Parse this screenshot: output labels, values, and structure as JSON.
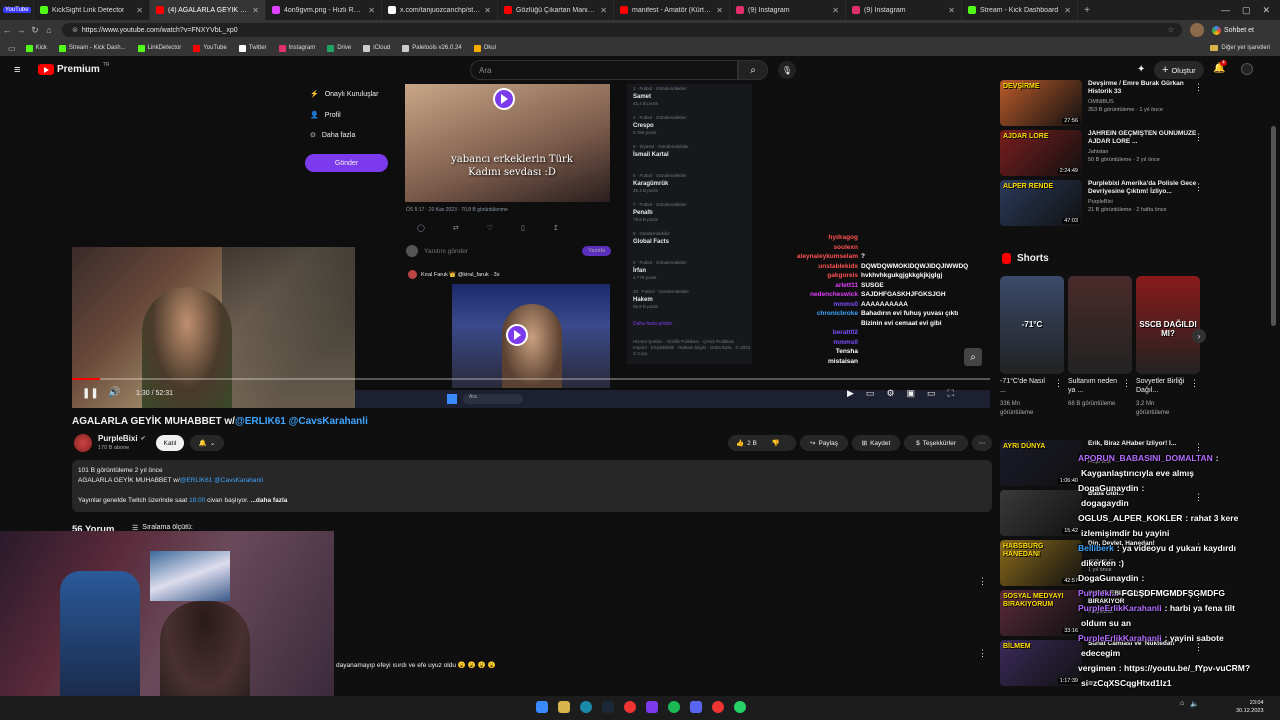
{
  "tabs": [
    {
      "label": "KickSight Link Detector",
      "color": "#53fc18"
    },
    {
      "label": "(4) AGALARLA GEYİK MUHABBET",
      "color": "#ff0000"
    },
    {
      "label": "4on9gvm.png - Hızlı Resim",
      "color": "#e040fb"
    },
    {
      "label": "x.com/tanjuozcanchp/status/2005",
      "color": "#ffffff"
    },
    {
      "label": "Gözlüğü Çıkartan Manifest Vlog -",
      "color": "#ff0000"
    },
    {
      "label": "manifest - Amatör (Kürtçe Cover)",
      "color": "#ff0000"
    },
    {
      "label": "(9) Instagram",
      "color": "#e1306c"
    },
    {
      "label": "(9) Instagram",
      "color": "#e1306c"
    },
    {
      "label": "Stream - Kick Dashboard",
      "color": "#53fc18"
    }
  ],
  "youtube_tab_badge": "YouTube",
  "url": "https://www.youtube.com/watch?v=FNXYVbL_xp0",
  "chat_button": "Sohbet et",
  "bookmarks": [
    {
      "label": "Kick",
      "color": "#53fc18"
    },
    {
      "label": "Stream - Kick Dash...",
      "color": "#53fc18"
    },
    {
      "label": "LinkDetector",
      "color": "#53fc18"
    },
    {
      "label": "YouTube",
      "color": "#ff0000"
    },
    {
      "label": "Twitter",
      "color": "#ffffff"
    },
    {
      "label": "Instagram",
      "color": "#e1306c"
    },
    {
      "label": "Drive",
      "color": "#1fa463"
    },
    {
      "label": "iCloud",
      "color": "#cccccc"
    },
    {
      "label": "Paletools v26.0.24",
      "color": "#cccccc"
    },
    {
      "label": "Okul",
      "color": "#f9ab00"
    }
  ],
  "other_bookmarks": "Diğer yer işaretleri",
  "yt": {
    "logo": "Premium",
    "logo_super": "TR",
    "search_placeholder": "Ara",
    "create": "Oluştur",
    "notif_count": "4"
  },
  "player": {
    "menu_items": [
      "Onaylı Kuruluşlar",
      "Profil",
      "Daha fazla"
    ],
    "send_button": "Gönder",
    "tweet_caption_line1": "yabancı erkeklerin Türk",
    "tweet_caption_line2": "Kadını sevdası :D",
    "tweet_meta": "ÖS 5:17 · 20 Kas 2023 · 70,8 B görüntülenme",
    "reply_placeholder": "Yanıtını gönder",
    "reply_button": "Yanıtla",
    "quote_user": "Kıral Faruk 👑 @kiral_faruk · 3s",
    "trends": [
      {
        "cat": "1 · Futbol · Gündemdekiler",
        "name": "Samet",
        "count": "45,4 B posts"
      },
      {
        "cat": "4 · Futbol · Gündemdekiler",
        "name": "Crespo",
        "count": "5.786 posts"
      },
      {
        "cat": "5 · Siyaset · Gündemdekiler",
        "name": "İsmail Kartal",
        "count": ""
      },
      {
        "cat": "6 · Futbol · Gündemdekiler",
        "name": "Karagümrük",
        "count": "25,4 B posts"
      },
      {
        "cat": "7 · Futbol · Gündemdekiler",
        "name": "Penaltı",
        "count": "79,8 B posts"
      },
      {
        "cat": "8 · Gündemdekiler",
        "name": "Global Facts",
        "count": ""
      },
      {
        "cat": "9 · Futbol · Gündemdekiler",
        "name": "İrfan",
        "count": "4.775 posts"
      },
      {
        "cat": "10 · Futbol · Gündemdekiler",
        "name": "Hakem",
        "count": "95,8 B posts"
      }
    ],
    "show_more": "Daha fazla göster",
    "footer": "Hizmet Şartları · Gizlilik Politikası · Çerez Politikası · Imprint · Erişilebilirlik · Reklam bilgisi · Daha fazla · © 2023 X Corp.",
    "chat": [
      {
        "user": "hydragog",
        "msg": "",
        "color": "#ff5252"
      },
      {
        "user": "soulexn",
        "msg": "",
        "color": "#ff5252"
      },
      {
        "user": "aleynaleykumselam",
        "msg": "?",
        "color": "#ff5252"
      },
      {
        "user": "unstablekidx",
        "msg": "DQWDQWMOKIDQWJIDQJIWWDQ",
        "color": "#ff5252"
      },
      {
        "user": "gakgoreis",
        "msg": "hvkhvhkgukgjgkkgkjkjglgj",
        "color": "#ff5252"
      },
      {
        "user": "arlett11",
        "msg": "SUSGE",
        "color": "#e040fb"
      },
      {
        "user": "nedencheswick",
        "msg": "SAJDHFGASKHJFGKSJGH",
        "color": "#e040fb"
      },
      {
        "user": "mmms0",
        "msg": "AAAAAAAAAA",
        "color": "#7c4dff"
      },
      {
        "user": "chronicbroke",
        "msg": "Bahadırın evi fuhuş yuvası çıktı",
        "color": "#3ea6ff"
      },
      {
        "user": "",
        "msg": "Bizinin evi cemaat evi gibi",
        "color": "#3ea6ff"
      },
      {
        "user": "beratt02",
        "msg": "",
        "color": "#7c4dff"
      },
      {
        "user": "mmms0",
        "msg": "",
        "color": "#7c4dff"
      },
      {
        "user": "Tensha",
        "msg": "",
        "color": "#ffffff"
      },
      {
        "user": "mistaisan",
        "msg": "",
        "color": "#ffffff"
      }
    ],
    "timecode": "1:30 / 52:31",
    "progress": 0.03,
    "taskbar_time": "23:04\n30.12.2023"
  },
  "video": {
    "title": "AGALARLA GEYİK MUHABBET w/",
    "title_links": "@ERLIK61 @CavsKarahanli",
    "channel": "PurpleBixi",
    "subscribers": "170 B abone",
    "join": "Katıl",
    "likes": "2 B",
    "share": "Paylaş",
    "save": "Kaydet",
    "thanks": "Teşekkürler"
  },
  "description": {
    "meta": "101 B görüntüleme  2 yıl önce",
    "line2_text": "AGALARLA GEYİK MUHABBET w/",
    "line2_links": "@ERLIK61 @CavsKarahanli",
    "line3_prefix": "Yayınlar genelde Twitch üzerinde saat",
    "line3_time": "18:00",
    "line3_suffix": "civarı başlıyor.",
    "more": "...daha fazla"
  },
  "comments": {
    "count": "56 Yorum",
    "sort": "Sıralama ölçütü:",
    "visible_comment": "dayanamayıp efeyi ısırdı ve efe uyuz oldu 😮 😮 😮 😮"
  },
  "recommended_top": [
    {
      "title": "Devşirme / Emre Burak Gürkan Historik 33",
      "channel": "OMNIBUS",
      "meta": "353 B görüntüleme · 1 yıl önce",
      "duration": "27:56",
      "thumb_text": "DEVŞİRME",
      "color": "#b85a2a"
    },
    {
      "title": "JAHREIN GEÇMİŞTEN GÜNÜMÜZE AJDAR LORE ...",
      "channel": "Jahistan",
      "meta": "50 B görüntüleme · 2 yıl önce",
      "duration": "2:24:49",
      "thumb_text": "AJDAR LORE",
      "color": "#7a1d1d"
    },
    {
      "title": "Purplebixi Amerika'da Polisle Gece Devriyesine Çıktım! İzliyo...",
      "channel": "PurpleBixi",
      "meta": "21 B görüntüleme · 2 hafta önce",
      "duration": "47:03",
      "thumb_text": "ALPER RENDE",
      "color": "#2a3a5a"
    }
  ],
  "shorts": {
    "heading": "Shorts",
    "items": [
      {
        "title": "-71°C'de Nasıl ...",
        "views": "336 Mn görüntüleme",
        "thumb_text": "-71°C",
        "color": "#3a4a6a"
      },
      {
        "title": "Sultanım neden ya ...",
        "views": "68 B görüntüleme",
        "thumb_text": "",
        "color": "#4a2a2a"
      },
      {
        "title": "Sovyetler Birliği Dağıl...",
        "views": "3,2 Mn görüntüleme",
        "thumb_text": "SSCB DAĞILDI MI?",
        "color": "#8a1a1a"
      }
    ]
  },
  "recommended_bottom": [
    {
      "title": "Erik, Biraz AHaber İzliyor! İ...",
      "channel": "Folja Erik",
      "meta": "",
      "duration": "1:06:40",
      "thumb_text": "AYRI DÜNYA",
      "color": "#1a1a2a"
    },
    {
      "title": "Baba Gibi...",
      "channel": "",
      "meta": "",
      "duration": "15:42",
      "thumb_text": "",
      "color": "#3a3a3a"
    },
    {
      "title": "Din, Devlet, Hanedan!",
      "channel": "OMNIBUS",
      "meta": "1 yıl önce",
      "duration": "42:57",
      "thumb_text": "HABSBURG HANEDANI",
      "color": "#8a6a1a"
    },
    {
      "title": "PURPLEBIXI SOSYAL MEDYAYI BIRAKIYOR",
      "channel": "PurpleBixi",
      "meta": "",
      "duration": "33:16",
      "thumb_text": "SOSYAL MEDYAYI BIRAKIYORUM",
      "color": "#5a2a3a"
    },
    {
      "title": "Sanat Camiası ve 'Nüktedan'",
      "channel": "",
      "meta": "3 saat önce",
      "duration": "1:17:39",
      "thumb_text": "BİLMEM",
      "color": "#3a2a5a"
    }
  ],
  "overlay_chat": [
    {
      "user": "APORUN_BABASINI_DOMALTAN",
      "msg": ":",
      "color": "#b46cff"
    },
    {
      "user": "",
      "msg": "Kayganlaştırıcıyla eve almış",
      "color": "#ffffff"
    },
    {
      "user": "DogaGunaydin",
      "msg": ":",
      "color": "#ffffff"
    },
    {
      "user": "",
      "msg": "dogagaydin",
      "color": "#ffffff"
    },
    {
      "user": "OGLUS_ALPER_KOKLER",
      "msg": ": rahat 3 kere",
      "color": "#ffffff"
    },
    {
      "user": "",
      "msg": "izlemişimdir bu yayini",
      "color": "#ffffff"
    },
    {
      "user": "Belliberk",
      "msg": ": ya videoyu d yukarı kaydırdı",
      "color": "#3ea6ff"
    },
    {
      "user": "",
      "msg": "dikerken :)",
      "color": "#ffffff"
    },
    {
      "user": "DogaGunaydin",
      "msg": ":",
      "color": "#ffffff"
    },
    {
      "user": "Purpleki...",
      "msg": "FGLŞDFMGMDFŞGMDFG",
      "color": "#b46cff"
    },
    {
      "user": "PurpleErlikKarahanli",
      "msg": ": harbi ya fena tilt",
      "color": "#b46cff"
    },
    {
      "user": "",
      "msg": "oldum su an",
      "color": "#ffffff"
    },
    {
      "user": "PurpleErlikKarahanli",
      "msg": ": yayini sabote",
      "color": "#b46cff"
    },
    {
      "user": "",
      "msg": "edecegim",
      "color": "#ffffff"
    },
    {
      "user": "vergimen",
      "msg": ": https://youtu.be/_fYpv-vuCRM?",
      "color": "#ffffff"
    },
    {
      "user": "",
      "msg": "si=zCqXSCqgHtxd1Iz1",
      "color": "#ffffff"
    }
  ],
  "taskbar": {
    "time": "23:04",
    "date": "30.12.2023"
  },
  "colors": {
    "kick_green": "#53fc18",
    "yt_red": "#ff0000",
    "purple": "#7c3aed",
    "link_blue": "#3ea6ff"
  }
}
